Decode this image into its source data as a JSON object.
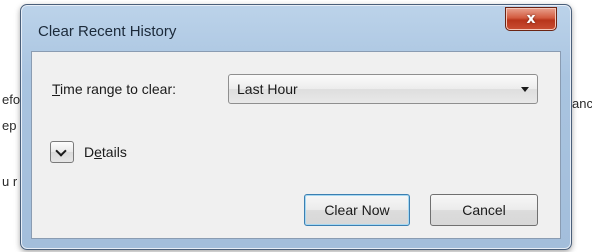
{
  "background": {
    "fragments": [
      "efo",
      "ep",
      "u r",
      "anc"
    ]
  },
  "dialog": {
    "title": "Clear Recent History",
    "close_glyph": "x",
    "time_range_label_underlined": "T",
    "time_range_label_rest": "ime range to clear:",
    "time_range_value": "Last Hour",
    "details_label_prefix": "D",
    "details_label_underlined": "e",
    "details_label_rest": "tails",
    "clear_now_label": "Clear Now",
    "cancel_label": "Cancel"
  },
  "colors": {
    "close_button": "#c94e33",
    "default_button_border": "#3c7fb1",
    "frame": "#a9c4e0"
  },
  "icons": {
    "close": "close-icon",
    "dropdown": "chevron-down-icon",
    "details_toggle": "chevron-down-icon"
  }
}
